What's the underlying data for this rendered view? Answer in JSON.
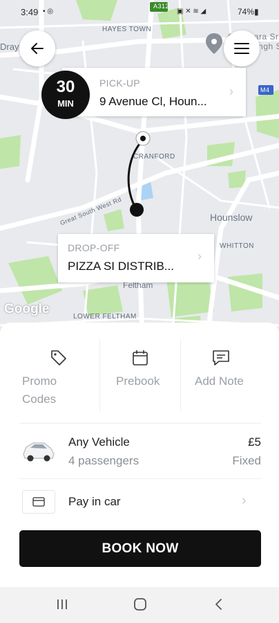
{
  "status_bar": {
    "time": "3:49",
    "left_icons": "▪ ◎",
    "right_icons": "▣ ✕ ≋ ◢",
    "battery": "74%▮"
  },
  "map": {
    "labels": {
      "hayes_town": "HAYES TOWN",
      "drayton": "Drayt",
      "cranford": "CRANFORD",
      "hounslow": "Hounslow",
      "whitton": "WHITTON",
      "feltham": "Feltham",
      "lower_feltham": "LOWER FELTHAM",
      "great_south_west_rd": "Great South West Rd",
      "road_a312": "A312",
      "road_m4": "M4",
      "gurdwara": "Gurdwara Sri\nGuru Singh Sabha"
    },
    "google_logo": "Google"
  },
  "header": {
    "back_icon": "arrow-left-icon",
    "menu_icon": "hamburger-icon"
  },
  "eta": {
    "minutes": "30",
    "unit": "MIN"
  },
  "pickup": {
    "label": "PICK-UP",
    "value": "9 Avenue Cl, Houn..."
  },
  "dropoff": {
    "label": "DROP-OFF",
    "value": "PIZZA SI DISTRIB..."
  },
  "actions": {
    "promo_line1": "Promo",
    "promo_line2": "Codes",
    "prebook": "Prebook",
    "add_note": "Add Note"
  },
  "vehicle": {
    "name": "Any Vehicle",
    "passengers": "4 passengers",
    "price": "£5",
    "price_type": "Fixed"
  },
  "payment": {
    "label": "Pay in car"
  },
  "book_button": "BOOK NOW",
  "colors": {
    "primary": "#111111",
    "map_bg": "#e8eaed",
    "park_green": "#b9e3a3",
    "muted_text": "#9aa0a6"
  }
}
